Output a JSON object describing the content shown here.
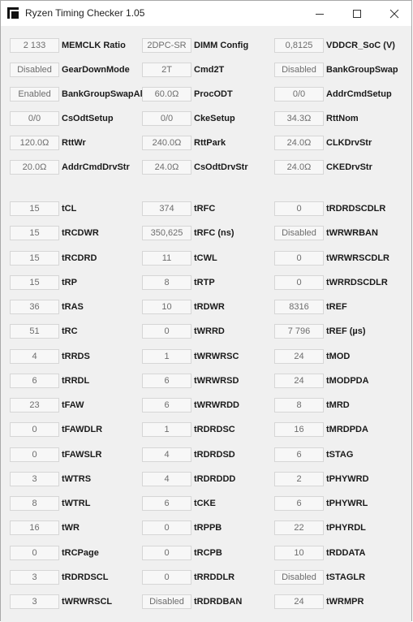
{
  "window": {
    "title": "Ryzen Timing Checker 1.05"
  },
  "columns": [
    [
      {
        "value": "2 133",
        "label": "MEMCLK Ratio"
      },
      {
        "value": "Disabled",
        "label": "GearDownMode"
      },
      {
        "value": "Enabled",
        "label": "BankGroupSwapAlt"
      },
      {
        "value": "0/0",
        "label": "CsOdtSetup"
      },
      {
        "value": "120.0Ω",
        "label": "RttWr"
      },
      {
        "value": "20.0Ω",
        "label": "AddrCmdDrvStr"
      },
      {
        "value": "15",
        "label": "tCL"
      },
      {
        "value": "15",
        "label": "tRCDWR"
      },
      {
        "value": "15",
        "label": "tRCDRD"
      },
      {
        "value": "15",
        "label": "tRP"
      },
      {
        "value": "36",
        "label": "tRAS"
      },
      {
        "value": "51",
        "label": "tRC"
      },
      {
        "value": "4",
        "label": "tRRDS"
      },
      {
        "value": "6",
        "label": "tRRDL"
      },
      {
        "value": "23",
        "label": "tFAW"
      },
      {
        "value": "0",
        "label": "tFAWDLR"
      },
      {
        "value": "0",
        "label": "tFAWSLR"
      },
      {
        "value": "3",
        "label": "tWTRS"
      },
      {
        "value": "8",
        "label": "tWTRL"
      },
      {
        "value": "16",
        "label": "tWR"
      },
      {
        "value": "0",
        "label": "tRCPage"
      },
      {
        "value": "3",
        "label": "tRDRDSCL"
      },
      {
        "value": "3",
        "label": "tWRWRSCL"
      }
    ],
    [
      {
        "value": "2DPC-SR",
        "label": "DIMM Config"
      },
      {
        "value": "2T",
        "label": "Cmd2T"
      },
      {
        "value": "60.0Ω",
        "label": "ProcODT"
      },
      {
        "value": "0/0",
        "label": "CkeSetup"
      },
      {
        "value": "240.0Ω",
        "label": "RttPark"
      },
      {
        "value": "24.0Ω",
        "label": "CsOdtDrvStr"
      },
      {
        "value": "374",
        "label": "tRFC"
      },
      {
        "value": "350,625",
        "label": "tRFC (ns)"
      },
      {
        "value": "11",
        "label": "tCWL"
      },
      {
        "value": "8",
        "label": "tRTP"
      },
      {
        "value": "10",
        "label": "tRDWR"
      },
      {
        "value": "0",
        "label": "tWRRD"
      },
      {
        "value": "1",
        "label": "tWRWRSC"
      },
      {
        "value": "6",
        "label": "tWRWRSD"
      },
      {
        "value": "6",
        "label": "tWRWRDD"
      },
      {
        "value": "1",
        "label": "tRDRDSC"
      },
      {
        "value": "4",
        "label": "tRDRDSD"
      },
      {
        "value": "4",
        "label": "tRDRDDD"
      },
      {
        "value": "6",
        "label": "tCKE"
      },
      {
        "value": "0",
        "label": "tRPPB"
      },
      {
        "value": "0",
        "label": "tRCPB"
      },
      {
        "value": "0",
        "label": "tRRDDLR"
      },
      {
        "value": "Disabled",
        "label": "tRDRDBAN"
      }
    ],
    [
      {
        "value": "0,8125",
        "label": "VDDCR_SoC (V)"
      },
      {
        "value": "Disabled",
        "label": "BankGroupSwap"
      },
      {
        "value": "0/0",
        "label": "AddrCmdSetup"
      },
      {
        "value": "34.3Ω",
        "label": "RttNom"
      },
      {
        "value": "24.0Ω",
        "label": "CLKDrvStr"
      },
      {
        "value": "24.0Ω",
        "label": "CKEDrvStr"
      },
      {
        "value": "0",
        "label": "tRDRDSCDLR"
      },
      {
        "value": "Disabled",
        "label": "tWRWRBAN"
      },
      {
        "value": "0",
        "label": "tWRWRSCDLR"
      },
      {
        "value": "0",
        "label": "tWRRDSCDLR"
      },
      {
        "value": "8316",
        "label": "tREF"
      },
      {
        "value": "7 796",
        "label": "tREF (µs)"
      },
      {
        "value": "24",
        "label": "tMOD"
      },
      {
        "value": "24",
        "label": "tMODPDA"
      },
      {
        "value": "8",
        "label": "tMRD"
      },
      {
        "value": "16",
        "label": "tMRDPDA"
      },
      {
        "value": "6",
        "label": "tSTAG"
      },
      {
        "value": "2",
        "label": "tPHYWRD"
      },
      {
        "value": "6",
        "label": "tPHYWRL"
      },
      {
        "value": "22",
        "label": "tPHYRDL"
      },
      {
        "value": "10",
        "label": "tRDDATA"
      },
      {
        "value": "Disabled",
        "label": "tSTAGLR"
      },
      {
        "value": "24",
        "label": "tWRMPR"
      }
    ]
  ]
}
